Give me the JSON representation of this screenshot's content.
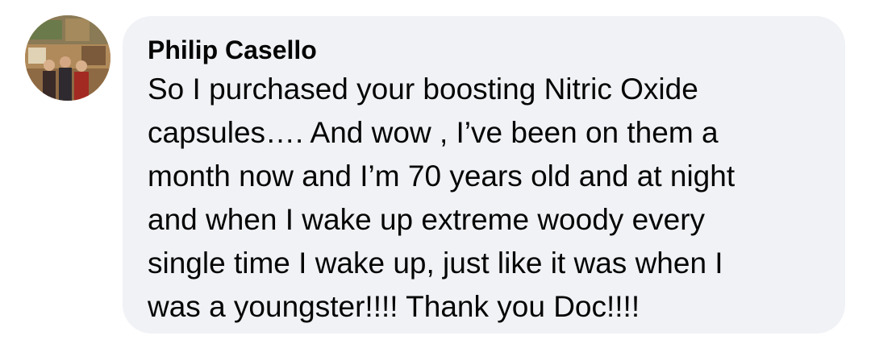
{
  "comment": {
    "author": "Philip Casello",
    "text": "So I purchased your boosting Nitric Oxide\ncapsules…. And wow , I’ve been on them a\nmonth now and I’m 70 years old and at night\nand when I wake up extreme woody every\nsingle time I wake up, just like it was when I\nwas a youngster!!!! Thank you Doc!!!!"
  },
  "colors": {
    "bubble_background": "#f0f2f5",
    "text": "#050505",
    "page_background": "#ffffff"
  }
}
